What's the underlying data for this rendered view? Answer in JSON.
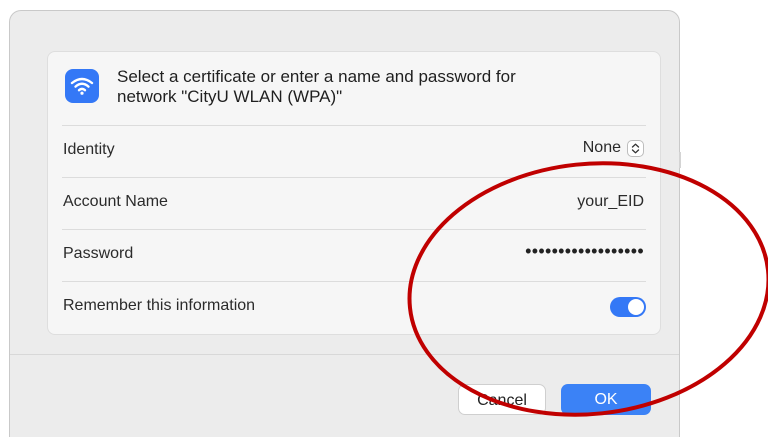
{
  "prompt": {
    "line1": "Select a certificate or enter a name and password for",
    "line2": "network \"CityU WLAN (WPA)\""
  },
  "fields": {
    "identity": {
      "label": "Identity",
      "value": "None"
    },
    "account_name": {
      "label": "Account Name",
      "value": "your_EID"
    },
    "password": {
      "label": "Password",
      "value": "••••••••••••••••••"
    },
    "remember": {
      "label": "Remember this information",
      "on": true
    }
  },
  "buttons": {
    "cancel": "Cancel",
    "ok": "OK"
  },
  "colors": {
    "accent": "#3478f6",
    "annotation": "#c00000"
  },
  "icons": {
    "network": "wifi-icon",
    "identity_select": "chevron-updown-icon"
  }
}
